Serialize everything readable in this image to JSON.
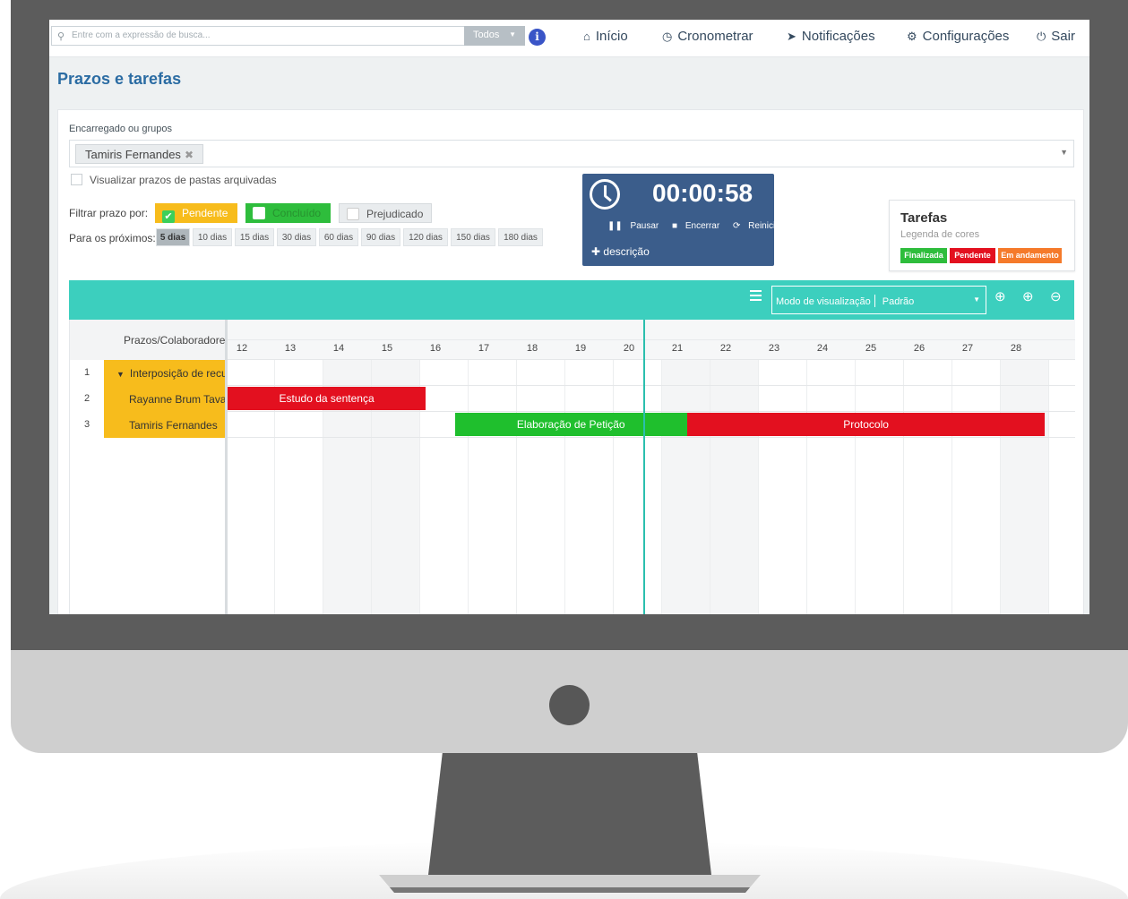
{
  "topbar": {
    "search_placeholder": "Entre com a expressão de busca...",
    "filter_label": "Todos",
    "nav": [
      {
        "label": "Início",
        "icon": "home-icon"
      },
      {
        "label": "Cronometrar",
        "icon": "clock-icon"
      },
      {
        "label": "Notificações",
        "icon": "send-icon"
      },
      {
        "label": "Configurações",
        "icon": "gear-icon"
      },
      {
        "label": "Sair",
        "icon": "power-icon"
      }
    ]
  },
  "page": {
    "title": "Prazos e tarefas"
  },
  "filters": {
    "assignee_label": "Encarregado ou grupos",
    "assignee_selected": "Tamiris Fernandes",
    "archived_label": "Visualizar prazos de pastas arquivadas",
    "filter_by_label": "Filtrar prazo por:",
    "status_buttons": [
      {
        "label": "Pendente",
        "checked": true,
        "color": "#f7bc1c"
      },
      {
        "label": "Concluído",
        "checked": false,
        "color": "#2ebd3c"
      },
      {
        "label": "Prejudicado",
        "checked": false,
        "color": "#e9ecee"
      }
    ],
    "next_label": "Para os próximos:",
    "periods": [
      "5 dias",
      "10 dias",
      "15 dias",
      "30 dias",
      "60 dias",
      "90 dias",
      "120 dias",
      "150 dias",
      "180 dias"
    ],
    "active_period": "5 dias"
  },
  "timer": {
    "time": "00:00:58",
    "pause_label": "Pausar",
    "stop_label": "Encerrar",
    "restart_label": "Reiniciar",
    "description_label": "descrição"
  },
  "legend": {
    "title": "Tarefas",
    "subtitle": "Legenda de cores",
    "items": [
      {
        "label": "Finalizada",
        "color": "#2ebd3c"
      },
      {
        "label": "Pendente",
        "color": "#e3101f"
      },
      {
        "label": "Em andamento",
        "color": "#f57a2a"
      }
    ]
  },
  "gantt": {
    "toolbar": {
      "mode_label": "Modo de visualização",
      "mode_value": "Padrão",
      "accent": "#3ccfbe"
    },
    "column_header": "Prazos/Colaboradores",
    "days": [
      "12",
      "13",
      "14",
      "15",
      "16",
      "17",
      "18",
      "19",
      "20",
      "21",
      "22",
      "23",
      "24",
      "25",
      "26",
      "27",
      "28"
    ],
    "rows": [
      {
        "num": "1",
        "name": "Interposição de recurso",
        "group": true
      },
      {
        "num": "2",
        "name": "Rayanne Brum Tavares",
        "group": false
      },
      {
        "num": "3",
        "name": "Tamiris Fernandes",
        "group": false
      }
    ],
    "tasks": [
      {
        "label": "Estudo da sentença",
        "row": 1,
        "start_day": 11.4,
        "end_day": 15.8,
        "color": "#e3101f"
      },
      {
        "label": "Elaboração de Petição",
        "row": 2,
        "start_day": 16.4,
        "end_day": 21.2,
        "color": "#1fbf2d"
      },
      {
        "label": "Protocolo",
        "row": 2,
        "start_day": 21.2,
        "end_day": 28.6,
        "color": "#e3101f"
      }
    ],
    "today_day": 20.3
  }
}
